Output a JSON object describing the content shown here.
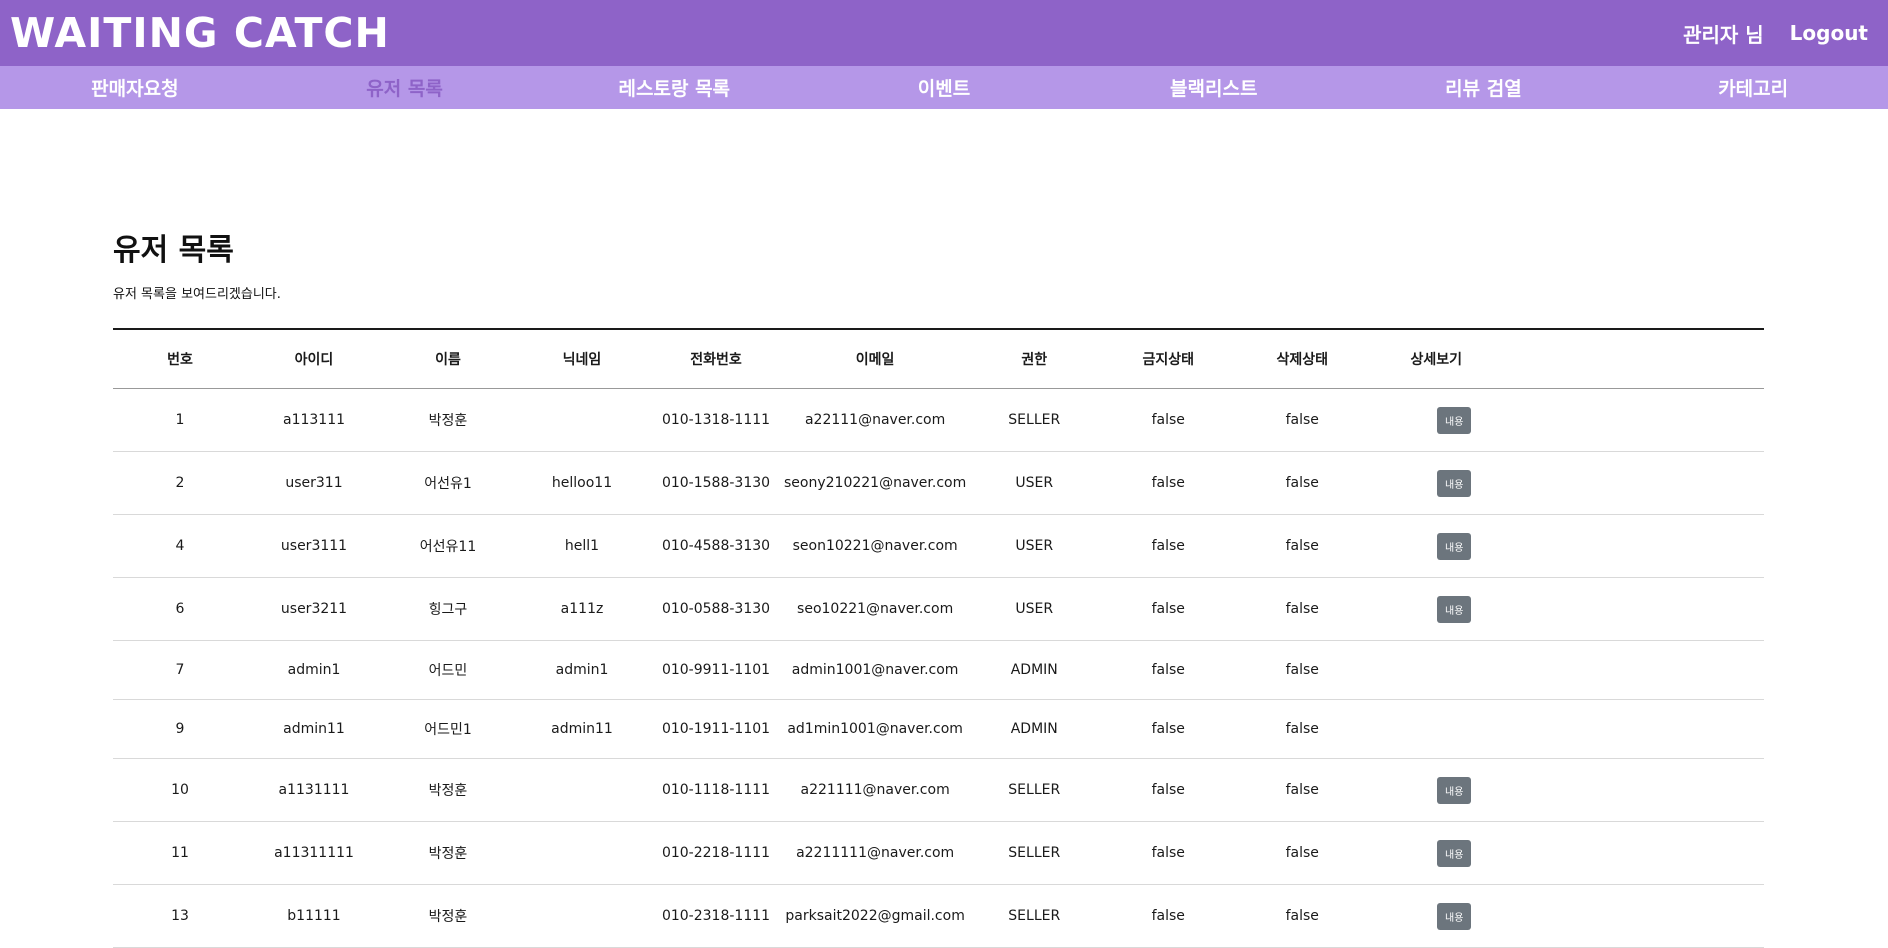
{
  "header": {
    "brand": "WAITING CATCH",
    "admin_label": "관리자 님",
    "logout_label": "Logout"
  },
  "nav": {
    "items": [
      {
        "label": "판매자요청"
      },
      {
        "label": "유저 목록"
      },
      {
        "label": "레스토랑 목록"
      },
      {
        "label": "이벤트"
      },
      {
        "label": "블랙리스트"
      },
      {
        "label": "리뷰 검열"
      },
      {
        "label": "카테고리"
      }
    ],
    "active": "유저 목록"
  },
  "main": {
    "title": "유저 목록",
    "description": "유저 목록을 보여드리겠습니다.",
    "table": {
      "headers": [
        "번호",
        "아이디",
        "이름",
        "닉네임",
        "전화번호",
        "이메일",
        "권한",
        "금지상태",
        "삭제상태",
        "상세보기"
      ],
      "detail_button_label": "내용",
      "rows": [
        {
          "num": "1",
          "id": "a113111",
          "name": "박정훈",
          "nick": "",
          "phone": "010-1318-1111",
          "email": "a22111@naver.com",
          "role": "SELLER",
          "banned": "false",
          "deleted": "false",
          "has_detail": true
        },
        {
          "num": "2",
          "id": "user311",
          "name": "어선유1",
          "nick": "helloo11",
          "phone": "010-1588-3130",
          "email": "seony210221@naver.com",
          "role": "USER",
          "banned": "false",
          "deleted": "false",
          "has_detail": true
        },
        {
          "num": "4",
          "id": "user3111",
          "name": "어선유11",
          "nick": "hell1",
          "phone": "010-4588-3130",
          "email": "seon10221@naver.com",
          "role": "USER",
          "banned": "false",
          "deleted": "false",
          "has_detail": true
        },
        {
          "num": "6",
          "id": "user3211",
          "name": "힝그구",
          "nick": "a111z",
          "phone": "010-0588-3130",
          "email": "seo10221@naver.com",
          "role": "USER",
          "banned": "false",
          "deleted": "false",
          "has_detail": true
        },
        {
          "num": "7",
          "id": "admin1",
          "name": "어드민",
          "nick": "admin1",
          "phone": "010-9911-1101",
          "email": "admin1001@naver.com",
          "role": "ADMIN",
          "banned": "false",
          "deleted": "false",
          "has_detail": false
        },
        {
          "num": "9",
          "id": "admin11",
          "name": "어드민1",
          "nick": "admin11",
          "phone": "010-1911-1101",
          "email": "ad1min1001@naver.com",
          "role": "ADMIN",
          "banned": "false",
          "deleted": "false",
          "has_detail": false
        },
        {
          "num": "10",
          "id": "a1131111",
          "name": "박정훈",
          "nick": "",
          "phone": "010-1118-1111",
          "email": "a221111@naver.com",
          "role": "SELLER",
          "banned": "false",
          "deleted": "false",
          "has_detail": true
        },
        {
          "num": "11",
          "id": "a11311111",
          "name": "박정훈",
          "nick": "",
          "phone": "010-2218-1111",
          "email": "a2211111@naver.com",
          "role": "SELLER",
          "banned": "false",
          "deleted": "false",
          "has_detail": true
        },
        {
          "num": "13",
          "id": "b11111",
          "name": "박정훈",
          "nick": "",
          "phone": "010-2318-1111",
          "email": "parksait2022@gmail.com",
          "role": "SELLER",
          "banned": "false",
          "deleted": "false",
          "has_detail": true
        }
      ]
    }
  }
}
